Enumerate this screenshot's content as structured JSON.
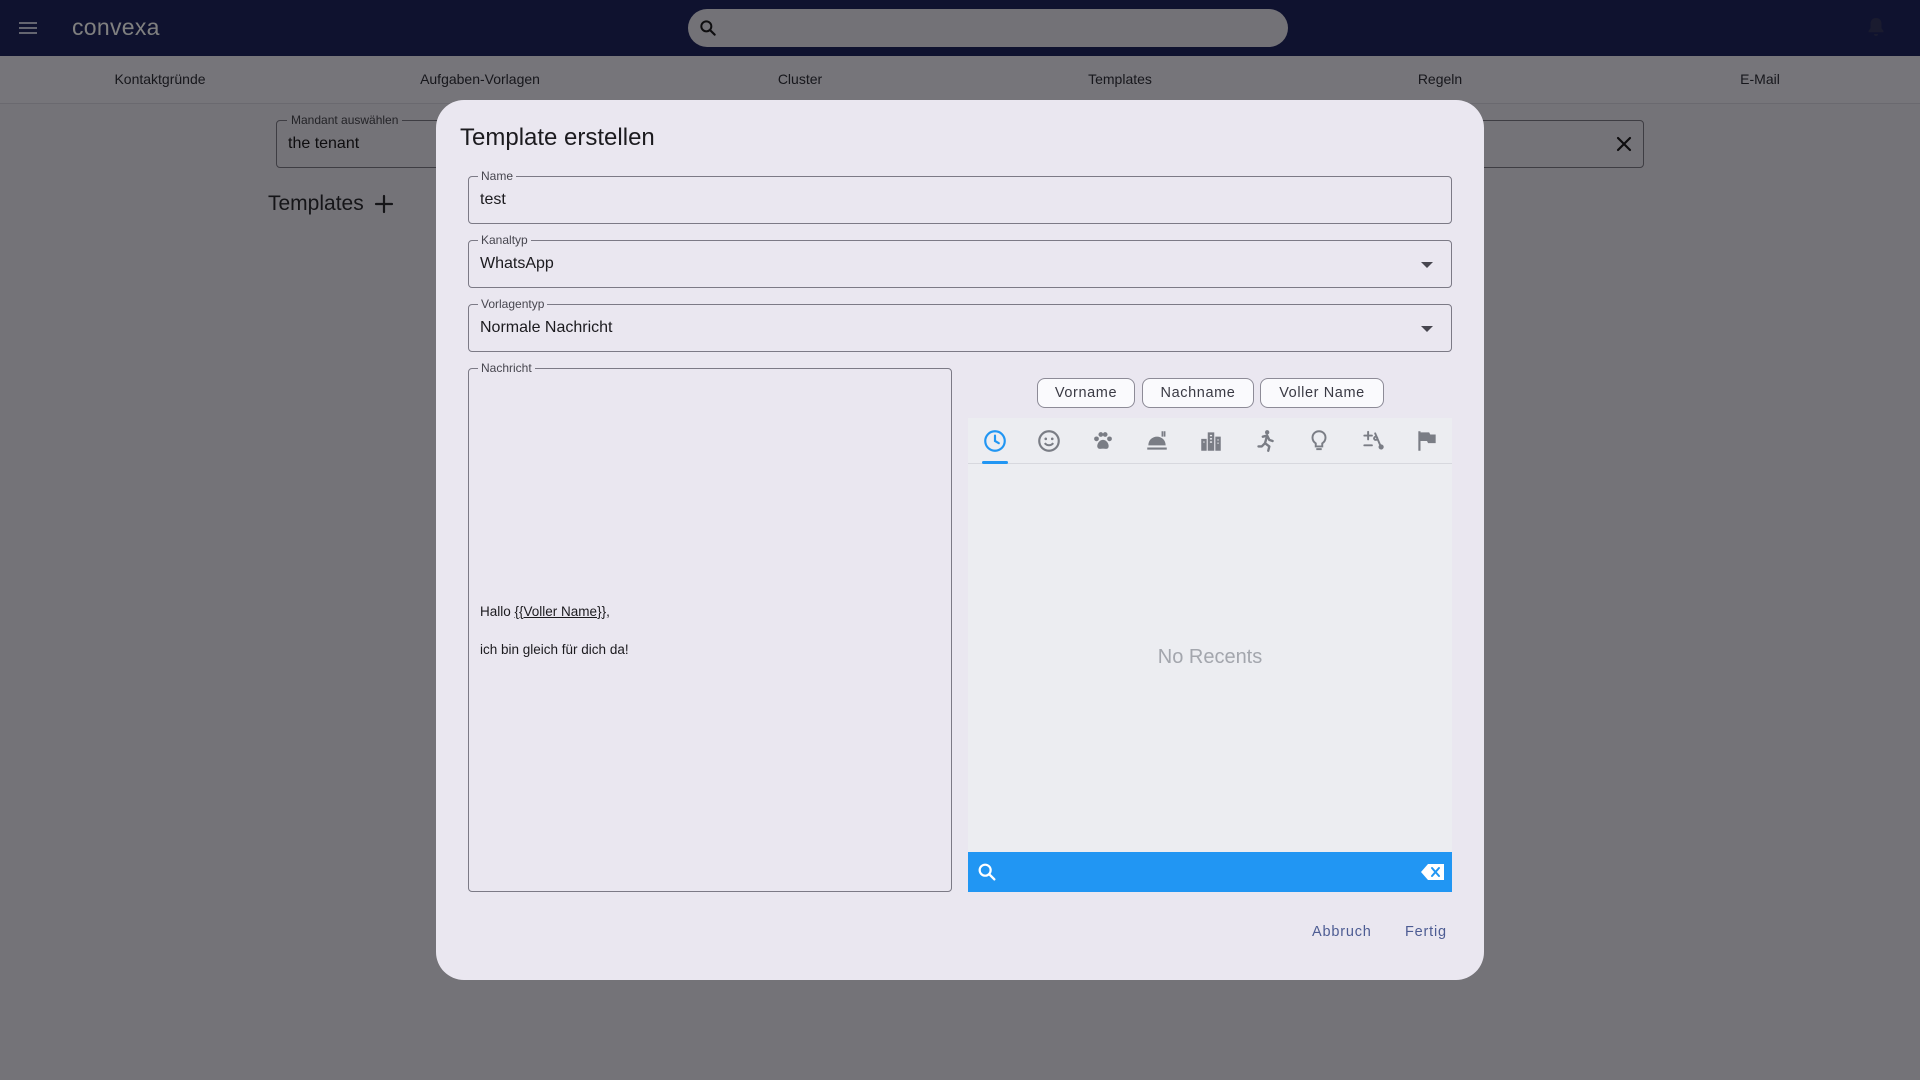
{
  "app": {
    "title": "convexa"
  },
  "header": {
    "menu_icon": "menu-icon",
    "search_icon": "search-icon",
    "search_placeholder": "",
    "notification_icon": "bell-icon"
  },
  "tabs": [
    {
      "label": "Kontaktgründe"
    },
    {
      "label": "Aufgaben-Vorlagen"
    },
    {
      "label": "Cluster"
    },
    {
      "label": "Templates"
    },
    {
      "label": "Regeln"
    },
    {
      "label": "E-Mail"
    }
  ],
  "tenant": {
    "label": "Mandant auswählen",
    "value": "the tenant",
    "clear_icon": "close-icon"
  },
  "section": {
    "title": "Templates",
    "add_icon": "add-icon"
  },
  "dialog": {
    "title": "Template erstellen",
    "name": {
      "label": "Name",
      "value": "test"
    },
    "channel": {
      "label": "Kanaltyp",
      "value": "WhatsApp"
    },
    "template_type": {
      "label": "Vorlagentyp",
      "value": "Normale Nachricht"
    },
    "message": {
      "label": "Nachricht",
      "greeting_prefix": "Hallo ",
      "placeholder_token": "{{Voller Name}}",
      "greeting_suffix": ",",
      "line2": "ich bin gleich für dich da!"
    },
    "chips": [
      {
        "label": "Vorname"
      },
      {
        "label": "Nachname"
      },
      {
        "label": "Voller Name"
      }
    ],
    "emoji_picker": {
      "categories": [
        "clock-icon",
        "smiley-icon",
        "paw-icon",
        "food-icon",
        "buildings-icon",
        "running-icon",
        "lightbulb-icon",
        "symbols-icon",
        "flag-icon"
      ],
      "active_category": "clock-icon",
      "empty_text": "No Recents",
      "accent_color": "#2196f3"
    },
    "actions": {
      "cancel": "Abbruch",
      "done": "Fertig"
    }
  },
  "colors": {
    "appbar": "#1f255e",
    "surface": "#eae7f0",
    "primary_text_button": "#4d5c93"
  }
}
